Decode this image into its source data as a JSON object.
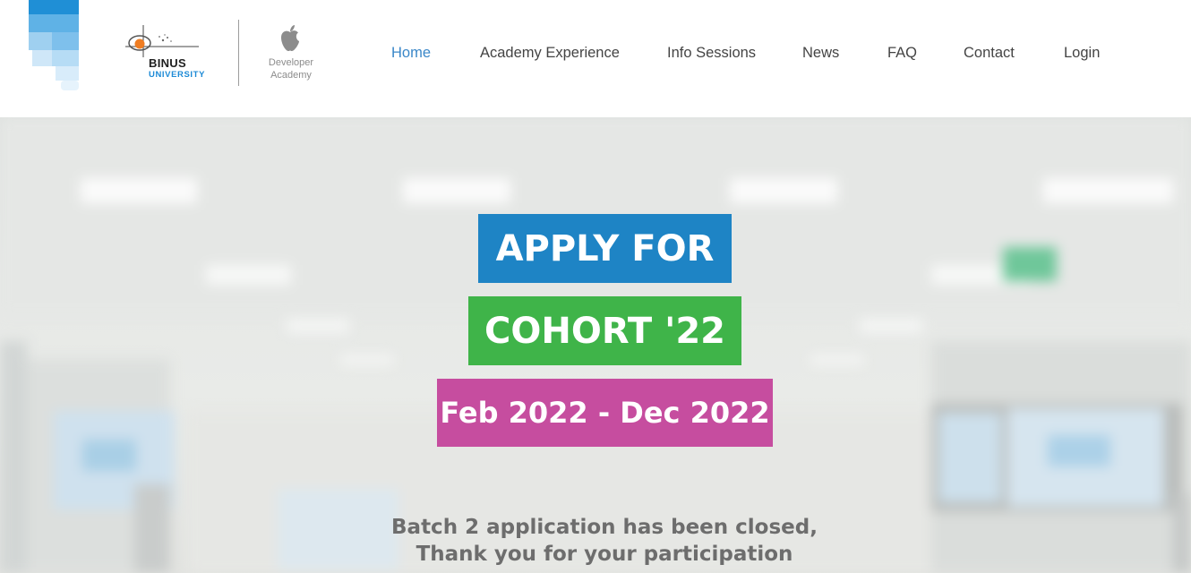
{
  "header": {
    "brand": {
      "university_name": "BINUS",
      "university_sub": "UNIVERSITY",
      "academy_line1": "Developer",
      "academy_line2": "Academy"
    },
    "nav": [
      {
        "label": "Home",
        "active": true
      },
      {
        "label": "Academy Experience",
        "active": false
      },
      {
        "label": "Info Sessions",
        "active": false
      },
      {
        "label": "News",
        "active": false
      },
      {
        "label": "FAQ",
        "active": false
      },
      {
        "label": "Contact",
        "active": false
      },
      {
        "label": "Login",
        "active": false
      }
    ]
  },
  "hero": {
    "headline_1": "APPLY FOR",
    "headline_2": "COHORT '22",
    "dates": "Feb 2022 - Dec 2022",
    "message_line1": "Batch 2 application has been closed,",
    "message_line2": "Thank you for your participation"
  },
  "colors": {
    "nav_active": "#3a87c8",
    "badge_apply": "#1e84c5",
    "badge_cohort": "#3fb449",
    "badge_dates": "#c64d9f",
    "message_text": "#6d6d6d"
  }
}
